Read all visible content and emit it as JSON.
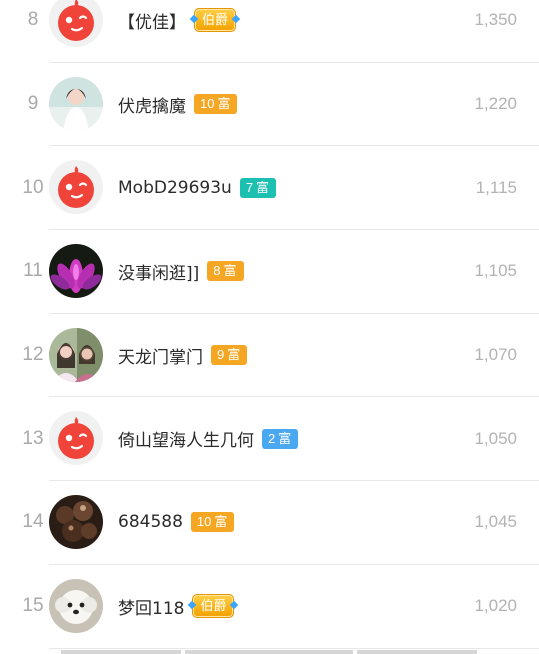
{
  "rows": [
    {
      "rank": "8",
      "name": "【优佳】",
      "badge_type": "count",
      "badge_text": "伯爵",
      "avatar": "mascot",
      "value": "1,350"
    },
    {
      "rank": "9",
      "name": "伏虎擒魔",
      "badge_type": "rich",
      "level": "10",
      "badge_text": "富",
      "badge_color": "#f5a623",
      "avatar": "photo-girl",
      "value": "1,220"
    },
    {
      "rank": "10",
      "name": "MobD29693u",
      "badge_type": "rich",
      "level": "7",
      "badge_text": "富",
      "badge_color": "#1cc0b1",
      "avatar": "mascot",
      "value": "1,115"
    },
    {
      "rank": "11",
      "name": "没事闲逛]]",
      "badge_type": "rich",
      "level": "8",
      "badge_text": "富",
      "badge_color": "#f5a623",
      "avatar": "photo-flower",
      "value": "1,105"
    },
    {
      "rank": "12",
      "name": "天龙门掌门",
      "badge_type": "rich",
      "level": "9",
      "badge_text": "富",
      "badge_color": "#f5a623",
      "avatar": "photo-women",
      "value": "1,070"
    },
    {
      "rank": "13",
      "name": "倚山望海人生几何",
      "badge_type": "rich",
      "level": "2",
      "badge_text": "富",
      "badge_color": "#4aa8f0",
      "avatar": "mascot",
      "value": "1,050"
    },
    {
      "rank": "14",
      "name": "684588",
      "badge_type": "rich",
      "level": "10",
      "badge_text": "富",
      "badge_color": "#f5a623",
      "avatar": "photo-dark",
      "value": "1,045"
    },
    {
      "rank": "15",
      "name": "梦回118",
      "badge_type": "count",
      "badge_text": "伯爵",
      "avatar": "photo-dog",
      "value": "1,020"
    }
  ]
}
